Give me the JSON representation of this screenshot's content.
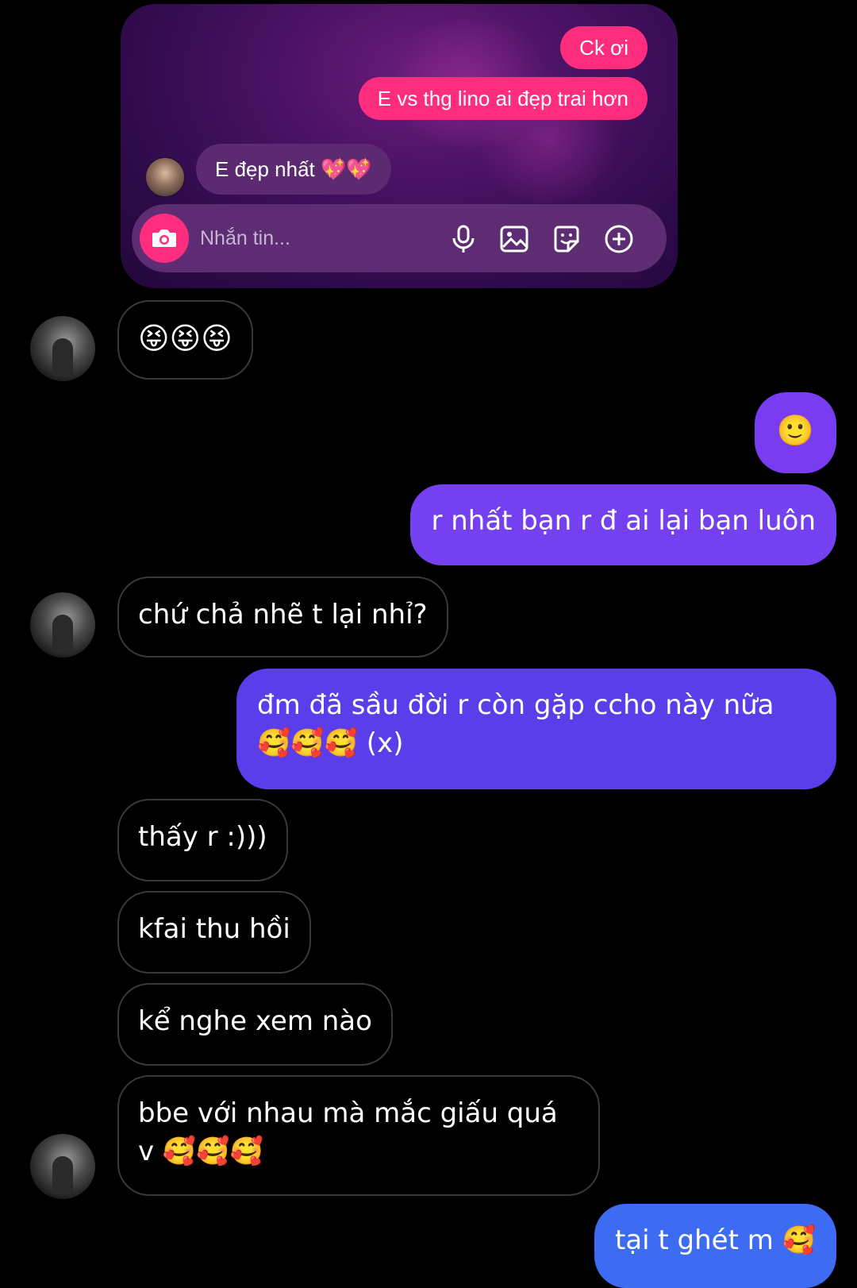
{
  "shared_card": {
    "msg1": "Ck ơi",
    "msg2": "E vs thg lino ai đẹp trai hơn",
    "reply": "E đẹp nhất 💖💖",
    "composer_placeholder": "Nhắn tin..."
  },
  "messages": {
    "m1": "😝😝😝",
    "m2": "🙂",
    "m3": "r nhất bạn r đ ai lại bạn luôn",
    "m4": "chứ chả nhẽ t lại nhỉ?",
    "m5_line1": "đm đã sầu đời r còn gặp ccho này nữa",
    "m5_line2": "🥰🥰🥰 (x)",
    "m6": "thấy r :)))",
    "m7": "kfai thu hồi",
    "m8": "kể nghe xem nào",
    "m9_line1": "bbe với nhau mà mắc giấu quá",
    "m9_line2": "v 🥰🥰🥰",
    "m10": "tại t ghét m 🥰"
  },
  "colors": {
    "outgoing_purple": "#7a3cf0",
    "outgoing_indigo": "#5a3eea",
    "outgoing_blue": "#3d6cf2",
    "card_pink": "#ff2d7d",
    "card_bg": "#3a0f58"
  },
  "icons": [
    "camera-icon",
    "microphone-icon",
    "image-icon",
    "sticker-icon",
    "plus-circle-icon"
  ]
}
